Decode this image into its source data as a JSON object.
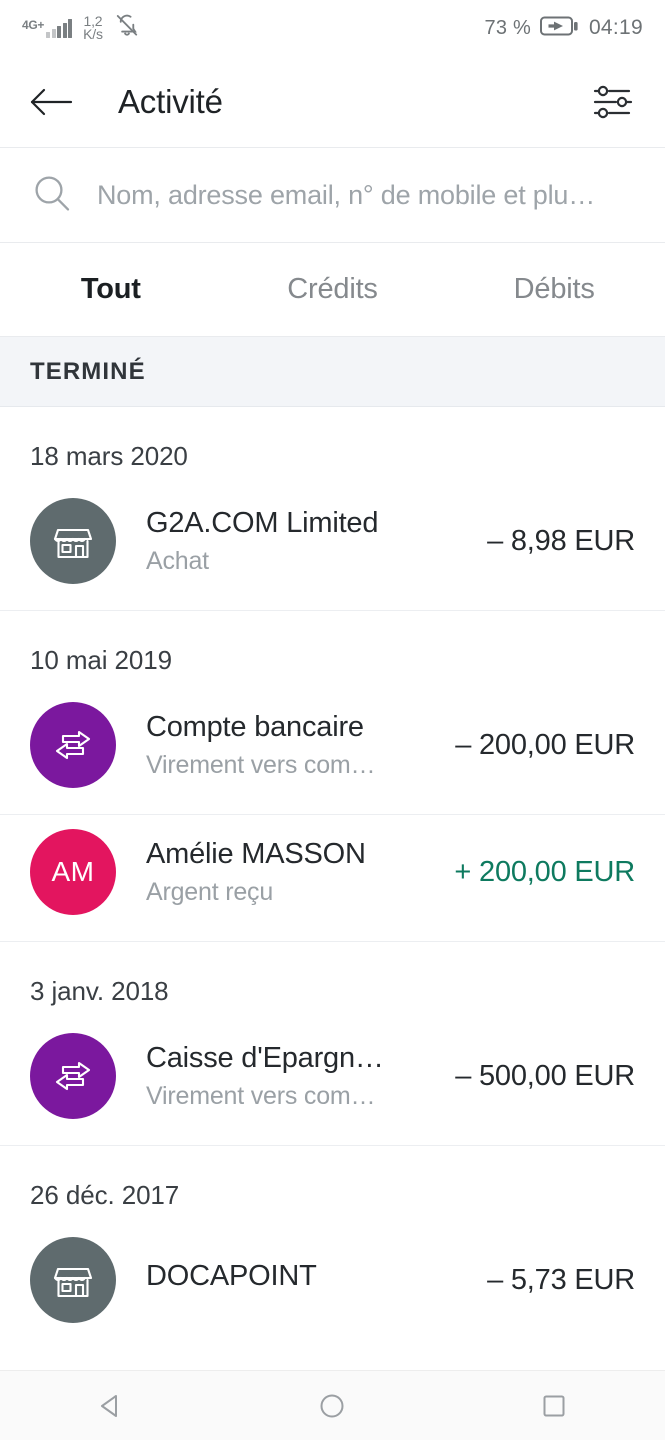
{
  "statusbar": {
    "network_label": "4G+",
    "data_rate_value": "1,2",
    "data_rate_unit": "K/s",
    "mute_icon": "bell-off-icon",
    "battery_percent": "73 %",
    "time": "04:19"
  },
  "appbar": {
    "back_icon": "arrow-left-icon",
    "title": "Activité",
    "filter_icon": "sliders-filter-icon"
  },
  "search": {
    "icon": "search-icon",
    "placeholder": "Nom, adresse email, n° de mobile et plu…",
    "value": ""
  },
  "tabs": [
    {
      "label": "Tout",
      "active": true
    },
    {
      "label": "Crédits",
      "active": false
    },
    {
      "label": "Débits",
      "active": false
    }
  ],
  "section": {
    "label": "TERMINÉ"
  },
  "groups": [
    {
      "date": "18 mars 2020",
      "transactions": [
        {
          "title": "G2A.COM Limited",
          "subtitle": "Achat",
          "amount": "– 8,98 EUR",
          "type": "debit",
          "avatar_kind": "shop-icon",
          "avatar_color": "#5f6b6e",
          "initials": ""
        }
      ]
    },
    {
      "date": "10 mai 2019",
      "transactions": [
        {
          "title": "Compte bancaire",
          "subtitle": "Virement vers com…",
          "amount": "– 200,00 EUR",
          "type": "debit",
          "avatar_kind": "transfer-icon",
          "avatar_color": "#7b189e",
          "initials": ""
        },
        {
          "title": "Amélie MASSON",
          "subtitle": "Argent reçu",
          "amount": "+ 200,00 EUR",
          "type": "credit",
          "avatar_kind": "initials",
          "avatar_color": "#e3155f",
          "initials": "AM"
        }
      ]
    },
    {
      "date": "3 janv. 2018",
      "transactions": [
        {
          "title": "Caisse d'Epargn…",
          "subtitle": "Virement vers com…",
          "amount": "– 500,00 EUR",
          "type": "debit",
          "avatar_kind": "transfer-icon",
          "avatar_color": "#7b189e",
          "initials": ""
        }
      ]
    },
    {
      "date": "26 déc. 2017",
      "transactions": [
        {
          "title": "DOCAPOINT",
          "subtitle": "",
          "amount": "– 5,73 EUR",
          "type": "debit",
          "avatar_kind": "shop-icon",
          "avatar_color": "#5f6b6e",
          "initials": ""
        }
      ]
    }
  ],
  "navbar": {
    "back_icon": "nav-back-triangle-icon",
    "home_icon": "nav-home-circle-icon",
    "recents_icon": "nav-recents-square-icon"
  },
  "colors": {
    "credit_green": "#0e7a5f",
    "transfer_purple": "#7b189e",
    "merchant_gray": "#5f6b6e",
    "person_pink": "#e3155f",
    "section_band": "#f3f5f8"
  }
}
